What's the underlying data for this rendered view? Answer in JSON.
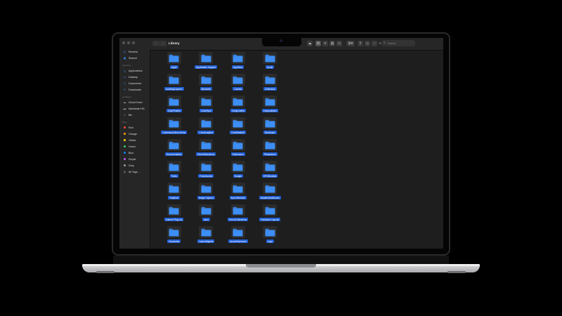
{
  "window": {
    "title": "Library"
  },
  "sidebar": {
    "items_top": [
      {
        "label": "Recents",
        "icon": "clock-icon"
      },
      {
        "label": "Shared",
        "icon": "shared-icon"
      }
    ],
    "favorites_header": "Favorites",
    "favorites": [
      {
        "label": "Applications",
        "icon": "applications-icon"
      },
      {
        "label": "Desktop",
        "icon": "desktop-icon"
      },
      {
        "label": "Documents",
        "icon": "document-icon"
      },
      {
        "label": "Downloads",
        "icon": "download-icon"
      }
    ],
    "locations_header": "Locations",
    "locations": [
      {
        "label": "iCloud Drive",
        "icon": "cloud-icon"
      },
      {
        "label": "Macintosh HD",
        "icon": "disk-icon"
      },
      {
        "label": "Bin",
        "icon": "trash-icon"
      }
    ],
    "tags_header": "Tags",
    "tags": [
      {
        "label": "Red",
        "color": "#ff453a"
      },
      {
        "label": "Orange",
        "color": "#ff9f0a"
      },
      {
        "label": "Yellow",
        "color": "#ffd60a"
      },
      {
        "label": "Green",
        "color": "#30d158"
      },
      {
        "label": "Blue",
        "color": "#0a84ff"
      },
      {
        "label": "Purple",
        "color": "#bf5af2"
      },
      {
        "label": "Grey",
        "color": "#98989d"
      }
    ],
    "all_tags": "All Tags…"
  },
  "search": {
    "placeholder": "Search"
  },
  "folders": [
    "Apple",
    "Application Support",
    "AppStore",
    "Audio",
    "AutoBugCapture",
    "Bluetooth",
    "Caches",
    "Calendars",
    "ColorPickers",
    "ColorSync",
    "Components",
    "Compositions",
    "Contextual Menu Items",
    "CoreAnalytics",
    "CoreMediaIO",
    "Developer",
    "Documentation",
    "DriverExtensions",
    "Extensions",
    "Filesystems",
    "Fonts",
    "Frameworks",
    "Google",
    "GPUBundles",
    "Graphics",
    "Image Capture",
    "Input Methods",
    "InstallerSandboxes",
    "Internet Plug-Ins",
    "Java",
    "KernelCollections",
    "Keyboard Layouts",
    "Keychains",
    "LaunchAgents",
    "LaunchDaemons",
    "Logs"
  ],
  "colors": {
    "folder": "#3d8ef5",
    "selection": "#1f5fd6"
  }
}
